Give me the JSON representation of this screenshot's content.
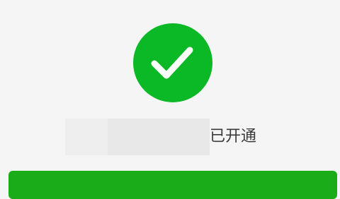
{
  "success_icon": {
    "name": "checkmark-icon",
    "circle_color": "#0bb826",
    "check_color": "#ffffff"
  },
  "status": {
    "text": "已开通"
  },
  "primary_button": {
    "color": "#1aad19"
  }
}
